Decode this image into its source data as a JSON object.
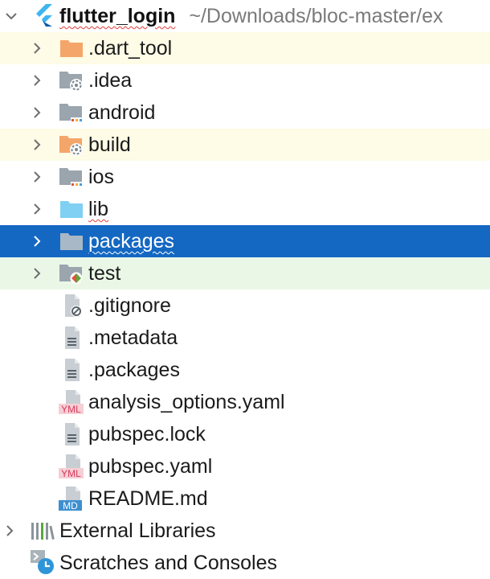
{
  "project": {
    "name": "flutter_login",
    "path": "~/Downloads/bloc-master/ex"
  },
  "items": [
    {
      "label": ".dart_tool",
      "icon": "folder-orange-icon"
    },
    {
      "label": ".idea",
      "icon": "settings-folder-icon"
    },
    {
      "label": "android",
      "icon": "module-folder-icon"
    },
    {
      "label": "build",
      "icon": "excluded-folder-icon"
    },
    {
      "label": "ios",
      "icon": "module-folder-icon"
    },
    {
      "label": "lib",
      "icon": "source-folder-icon"
    },
    {
      "label": "packages",
      "icon": "folder-icon"
    },
    {
      "label": "test",
      "icon": "test-folder-icon"
    },
    {
      "label": ".gitignore",
      "icon": "ignored-file-icon"
    },
    {
      "label": ".metadata",
      "icon": "text-file-icon"
    },
    {
      "label": ".packages",
      "icon": "text-file-icon"
    },
    {
      "label": "analysis_options.yaml",
      "icon": "yaml-file-icon",
      "badge": "YML"
    },
    {
      "label": "pubspec.lock",
      "icon": "text-file-icon"
    },
    {
      "label": "pubspec.yaml",
      "icon": "yaml-file-icon",
      "badge": "YML"
    },
    {
      "label": "README.md",
      "icon": "markdown-file-icon",
      "badge": "MD"
    }
  ],
  "external_libraries": {
    "label": "External Libraries"
  },
  "scratches": {
    "label": "Scratches and Consoles"
  },
  "colors": {
    "selection": "#1468c2",
    "excluded_row": "#fefbe6",
    "test_row": "#eaf7e7",
    "folder_orange": "#f4a66a",
    "folder_grey": "#9aa5ae",
    "folder_blue": "#7fd0f2",
    "flutter_blue": "#3fb6f0"
  }
}
